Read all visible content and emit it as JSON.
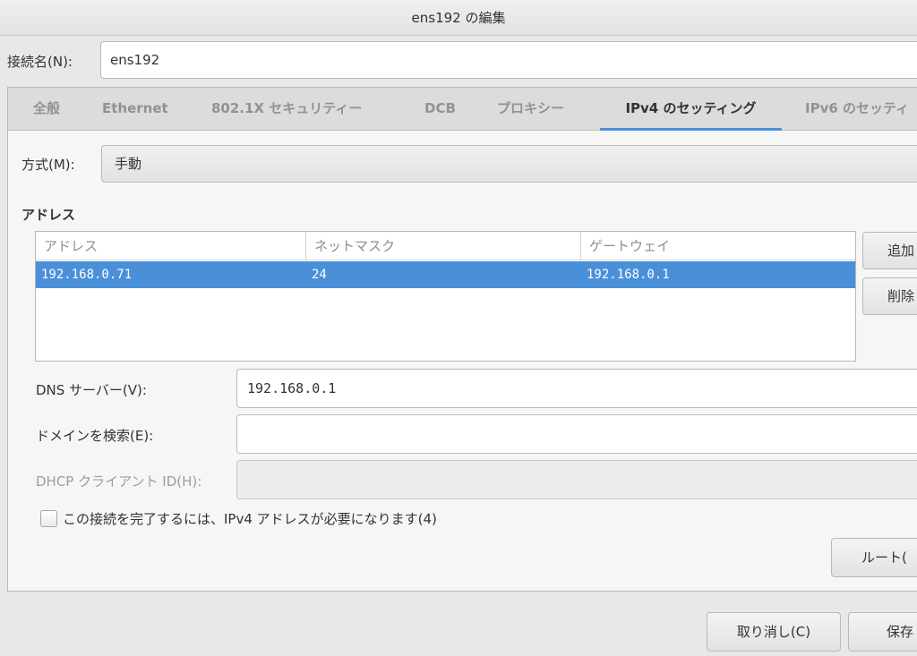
{
  "window": {
    "title": "ens192 の編集"
  },
  "connection": {
    "label": "接続名(N):",
    "value": "ens192"
  },
  "tabs": [
    {
      "label": "全般"
    },
    {
      "label": "Ethernet"
    },
    {
      "label": "802.1X セキュリティー"
    },
    {
      "label": "DCB"
    },
    {
      "label": "プロキシー"
    },
    {
      "label": "IPv4 のセッティング"
    },
    {
      "label": "IPv6 のセッティ"
    }
  ],
  "ipv4": {
    "method_label": "方式(M):",
    "method_value": "手動",
    "address_section_title": "アドレス",
    "columns": [
      "アドレス",
      "ネットマスク",
      "ゲートウェイ"
    ],
    "rows": [
      {
        "address": "192.168.0.71",
        "netmask": "24",
        "gateway": "192.168.0.1"
      }
    ],
    "add_button": "追加",
    "delete_button": "削除",
    "dns_label": "DNS サーバー(V):",
    "dns_value": "192.168.0.1",
    "search_domain_label": "ドメインを検索(E):",
    "search_domain_value": "",
    "dhcp_client_id_label": "DHCP クライアント ID(H):",
    "dhcp_client_id_value": "",
    "require_ipv4_label": "この接続を完了するには、IPv4 アドレスが必要になります(4)",
    "require_ipv4_checked": false,
    "routes_button": "ルート("
  },
  "footer": {
    "cancel_button": "取り消し(C)",
    "save_button": "保存"
  },
  "colors": {
    "accent": "#4a90d9",
    "background": "#e8e8e7"
  }
}
